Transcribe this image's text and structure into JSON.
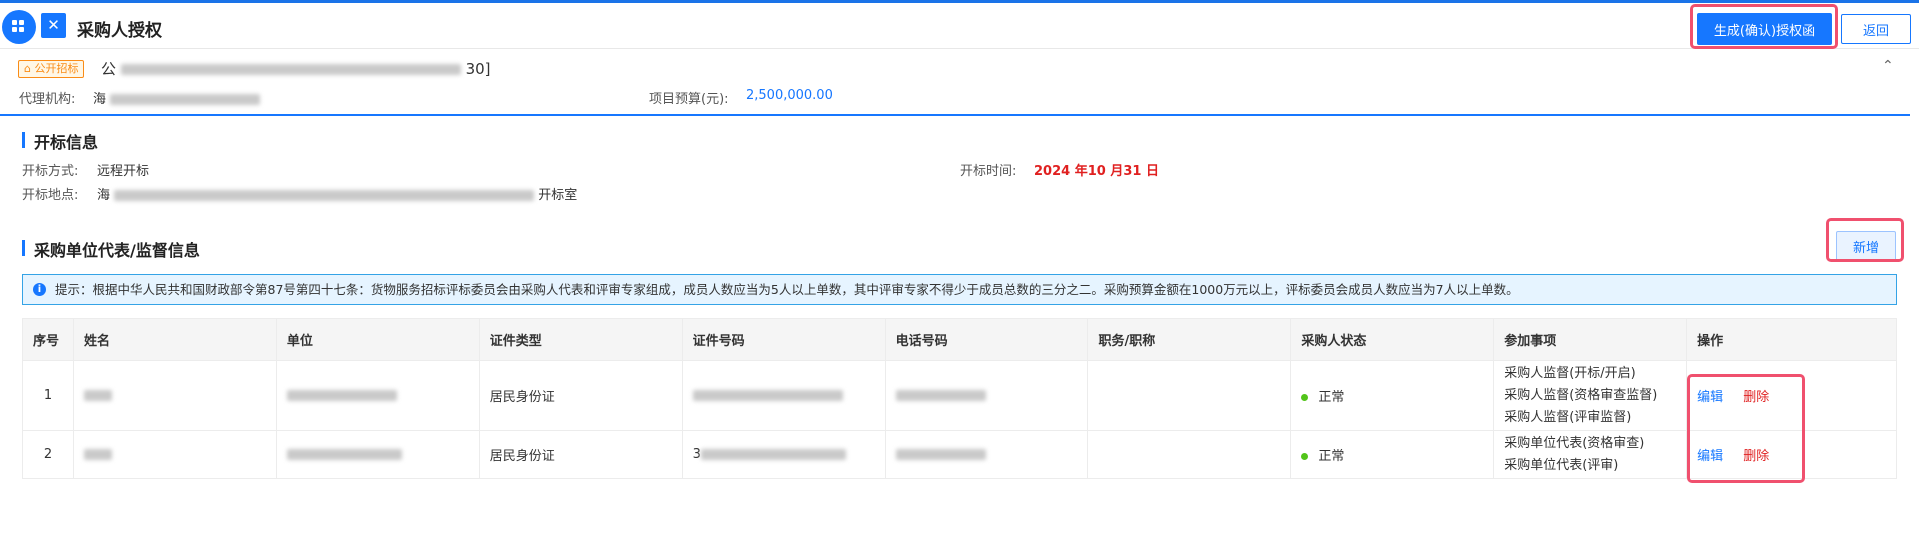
{
  "header": {
    "title": "采购人授权",
    "generate_label": "生成(确认)授权函",
    "back_label": "返回"
  },
  "project": {
    "tag": "公开招标",
    "name_prefix": "公",
    "name_suffix": "30]",
    "agency_label": "代理机构:",
    "agency_value_prefix": "海",
    "budget_label": "项目预算(元):",
    "budget_value": "2,500,000.00"
  },
  "opening": {
    "section_title": "开标信息",
    "method_label": "开标方式:",
    "method_value": "远程开标",
    "time_label": "开标时间:",
    "time_value": "2024 年10 月31 日",
    "place_label": "开标地点:",
    "place_prefix": "海",
    "place_suffix": "开标室"
  },
  "reps": {
    "section_title": "采购单位代表/监督信息",
    "add_label": "新增",
    "notice": "提示：根据中华人民共和国财政部令第87号第四十七条：货物服务招标评标委员会由采购人代表和评审专家组成，成员人数应当为5人以上单数，其中评审专家不得少于成员总数的三分之二。采购预算金额在1000万元以上，评标委员会成员人数应当为7人以上单数。",
    "columns": [
      "序号",
      "姓名",
      "单位",
      "证件类型",
      "证件号码",
      "电话号码",
      "职务/职称",
      "采购人状态",
      "参加事项",
      "操作"
    ],
    "rows": [
      {
        "index": "1",
        "id_type": "居民身份证",
        "id_prefix": "",
        "status": "正常",
        "matters": [
          "采购人监督(开标/开启)",
          "采购人监督(资格审查监督)",
          "采购人监督(评审监督)"
        ],
        "edit": "编辑",
        "delete": "删除"
      },
      {
        "index": "2",
        "id_type": "居民身份证",
        "id_prefix": "3",
        "status": "正常",
        "matters": [
          "采购单位代表(资格审查)",
          "采购单位代表(评审)"
        ],
        "edit": "编辑",
        "delete": "删除"
      }
    ]
  },
  "colors": {
    "primary": "#1677ff",
    "danger": "#e02020",
    "tag": "#fa8c16",
    "highlight": "#f0506e",
    "status_ok": "#52c41a"
  }
}
